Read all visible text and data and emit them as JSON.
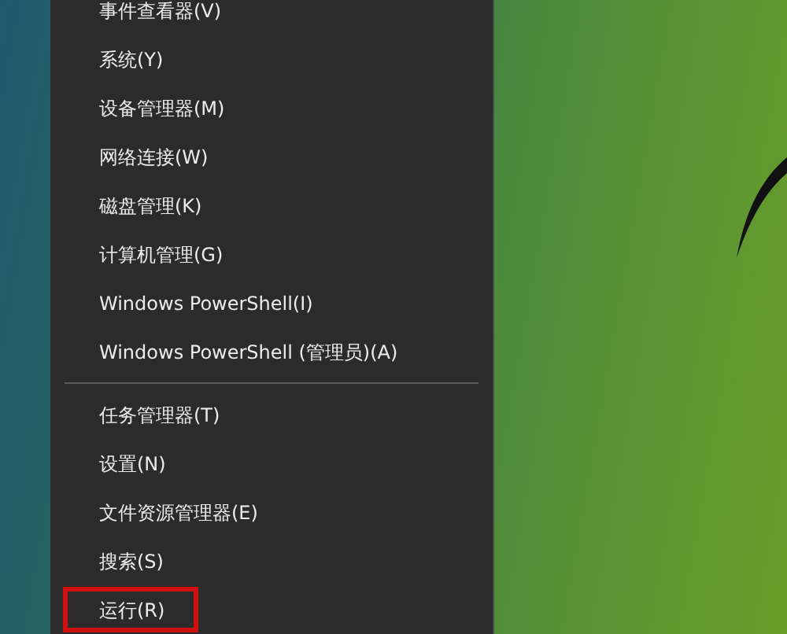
{
  "menu": {
    "groups": [
      {
        "items": [
          {
            "label": "事件查看器(V)",
            "highlighted": false
          },
          {
            "label": "系统(Y)",
            "highlighted": false
          },
          {
            "label": "设备管理器(M)",
            "highlighted": false
          },
          {
            "label": "网络连接(W)",
            "highlighted": false
          },
          {
            "label": "磁盘管理(K)",
            "highlighted": false
          },
          {
            "label": "计算机管理(G)",
            "highlighted": false
          },
          {
            "label": "Windows PowerShell(I)",
            "highlighted": false
          },
          {
            "label": "Windows PowerShell (管理员)(A)",
            "highlighted": false
          }
        ]
      },
      {
        "items": [
          {
            "label": "任务管理器(T)",
            "highlighted": false
          },
          {
            "label": "设置(N)",
            "highlighted": false
          },
          {
            "label": "文件资源管理器(E)",
            "highlighted": false
          },
          {
            "label": "搜索(S)",
            "highlighted": false
          },
          {
            "label": "运行(R)",
            "highlighted": true
          }
        ]
      }
    ]
  }
}
